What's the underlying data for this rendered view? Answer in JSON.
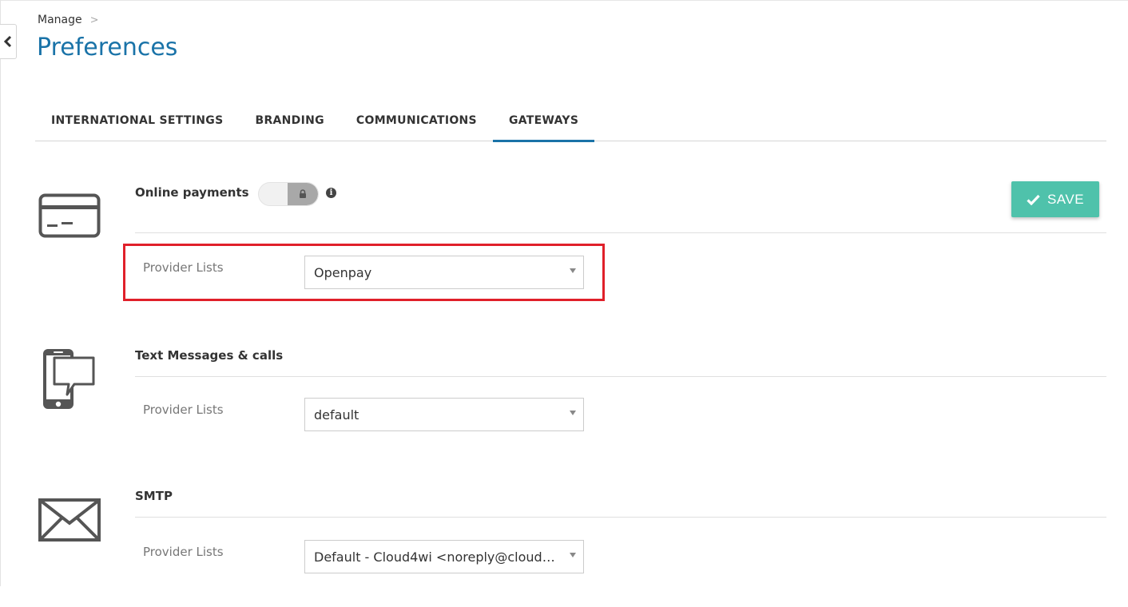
{
  "breadcrumb": {
    "parent": "Manage"
  },
  "page": {
    "title": "Preferences"
  },
  "tabs": [
    {
      "label": "INTERNATIONAL SETTINGS"
    },
    {
      "label": "BRANDING"
    },
    {
      "label": "COMMUNICATIONS"
    },
    {
      "label": "GATEWAYS",
      "active": true
    }
  ],
  "toolbar": {
    "save_label": "SAVE"
  },
  "sections": {
    "payments": {
      "title": "Online payments",
      "toggle_state": "off-locked",
      "field_label": "Provider Lists",
      "selected": "Openpay"
    },
    "sms": {
      "title": "Text Messages & calls",
      "field_label": "Provider Lists",
      "selected": "default"
    },
    "smtp": {
      "title": "SMTP",
      "field_label": "Provider Lists",
      "selected": "Default - Cloud4wi <noreply@cloud4..."
    }
  },
  "colors": {
    "accent": "#1a73a8",
    "save": "#4fc2ab",
    "highlight": "#e0202a"
  }
}
